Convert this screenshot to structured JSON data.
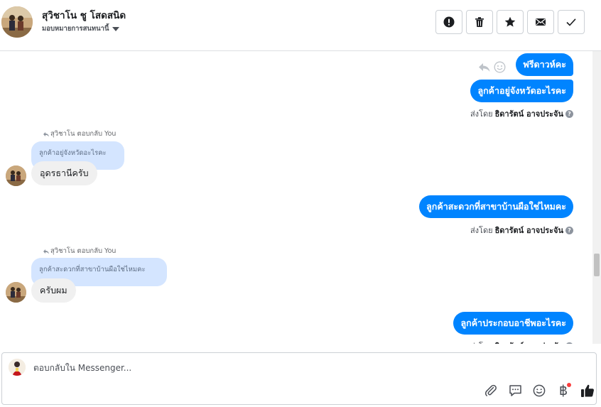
{
  "header": {
    "contact_name": "สุวิชาโน ชู โสดสนิด",
    "assign_label": "มอบหมายการสนทนานี้",
    "actions": [
      {
        "name": "spam-button",
        "icon": "alert-circle-icon"
      },
      {
        "name": "delete-button",
        "icon": "trash-icon"
      },
      {
        "name": "star-button",
        "icon": "star-icon"
      },
      {
        "name": "mark-unread-button",
        "icon": "envelope-icon"
      },
      {
        "name": "mark-done-button",
        "icon": "check-icon"
      }
    ]
  },
  "conversation": {
    "outgoing_1": "ฟรีดาวห์คะ",
    "outgoing_2": "ลูกค้าอยู่จังหวัดอะไรคะ",
    "sent_by_prefix": "ส่งโดย",
    "sent_by_name": "ธิดารัตน์ อาจประจัน",
    "reply_meta_1": "สุวิชาโน ตอบกลับ You",
    "quote_1": "ลูกค้าอยู่จังหวัดอะไรคะ",
    "incoming_1": "อุดรธานีครับ",
    "outgoing_3": "ลูกค้าสะดวกที่สาขาบ้านผือใช่ไหมคะ",
    "reply_meta_2": "สุวิชาโน ตอบกลับ You",
    "quote_2": "ลูกค้าสะดวกที่สาขาบ้านผือใช่ไหมคะ",
    "incoming_2": "ครับผม",
    "outgoing_4": "ลูกค้าประกอบอาชีพอะไรคะ"
  },
  "composer": {
    "placeholder": "ตอบกลับใน Messenger...",
    "tools": [
      "paperclip-icon",
      "quick-reply-icon",
      "emoji-icon",
      "baht-icon",
      "thumbs-up-icon"
    ]
  },
  "colors": {
    "outgoing_bubble": "#0084ff",
    "incoming_bubble": "#f0f0f0",
    "quote_bubble": "#d4e5ff",
    "like_blue": "#1c1e21"
  }
}
